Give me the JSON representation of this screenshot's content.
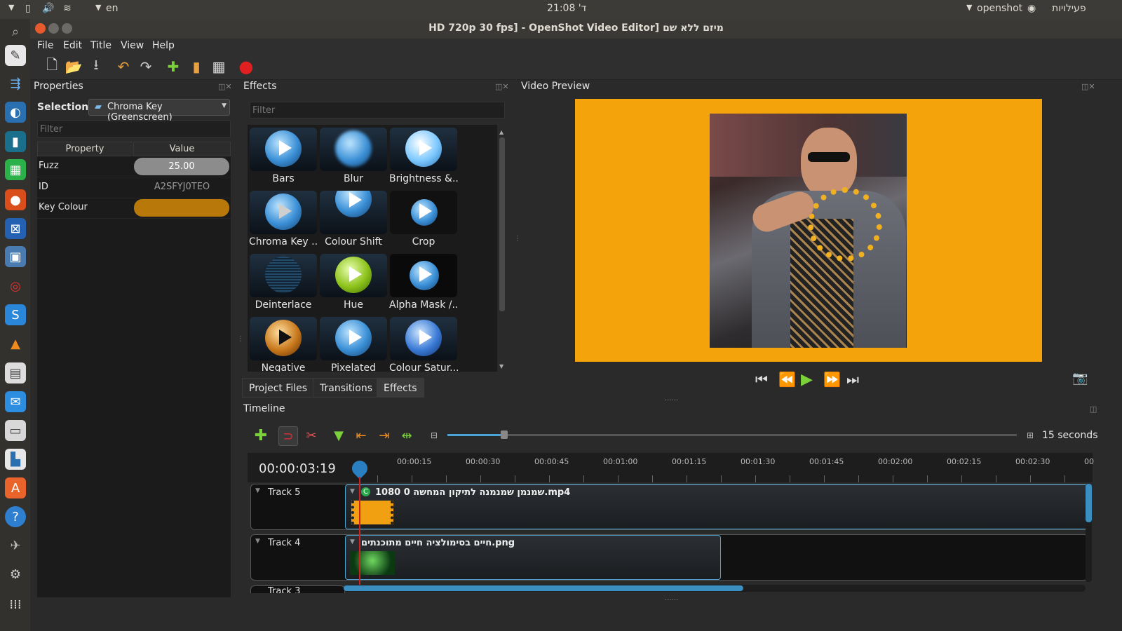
{
  "top_panel": {
    "lang": "en",
    "clock": "ד' 21:08",
    "app_menu": "openshot",
    "activities": "פעילויות"
  },
  "window": {
    "title": "HD 720p 30 fps] - OpenShot Video Editor] מיזם ללא שם"
  },
  "menu": [
    "File",
    "Edit",
    "Title",
    "View",
    "Help"
  ],
  "properties": {
    "title": "Properties",
    "selection_label": "Selection:",
    "selection_value": "Chroma Key (Greenscreen)",
    "filter_placeholder": "Filter",
    "col_property": "Property",
    "col_value": "Value",
    "rows": [
      {
        "name": "Fuzz",
        "value": "25.00"
      },
      {
        "name": "ID",
        "value": "A2SFYJ0TEO"
      },
      {
        "name": "Key Colour",
        "value": ""
      }
    ],
    "key_colour": "#b8780a"
  },
  "effects": {
    "title": "Effects",
    "filter_placeholder": "Filter",
    "items": [
      "Bars",
      "Blur",
      "Brightness &...",
      "Chroma Key ...",
      "Colour Shift",
      "Crop",
      "Deinterlace",
      "Hue",
      "Alpha Mask /...",
      "Negative",
      "Pixelated",
      "Colour Satur..."
    ],
    "tabs": [
      "Project Files",
      "Transitions",
      "Effects"
    ]
  },
  "preview": {
    "title": "Video Preview",
    "background_color": "#f4a30a"
  },
  "timeline": {
    "title": "Timeline",
    "timecode": "00:00:03:19",
    "zoom_label": "15 seconds",
    "zoom_level": 0.1,
    "ticks": [
      "00:00:15",
      "00:00:30",
      "00:00:45",
      "00:01:00",
      "00:01:15",
      "00:01:30",
      "00:01:45",
      "00:02:00",
      "00:02:15",
      "00:02:30",
      "00"
    ],
    "tracks": [
      {
        "name": "Track 5",
        "clip": "שמנמן שמנמנה לתיקון המחשה 0 1080.mp4",
        "clip_prefix": "C"
      },
      {
        "name": "Track 4",
        "clip": "חיים בסימולציה חיים מתוכנתים.png"
      },
      {
        "name": "Track 3"
      }
    ]
  }
}
